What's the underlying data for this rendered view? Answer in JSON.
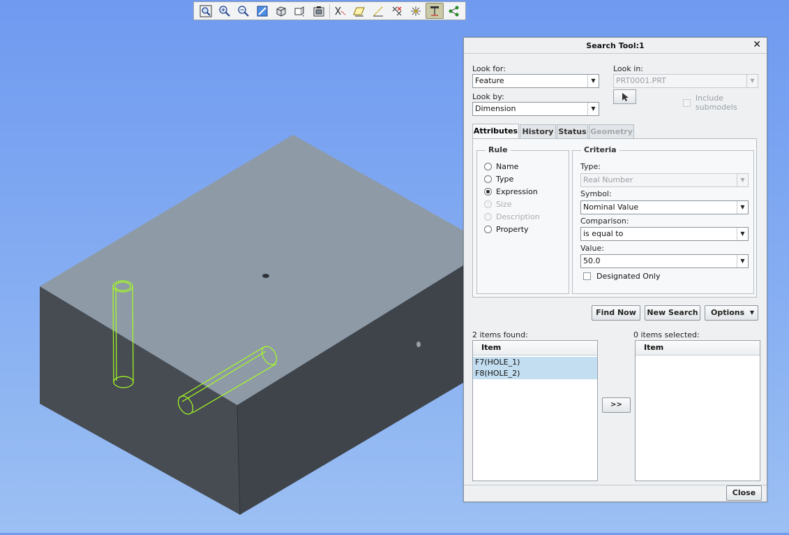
{
  "toolbar": {
    "buttons": [
      {
        "name": "refit-icon"
      },
      {
        "name": "zoom-in-icon"
      },
      {
        "name": "zoom-out-icon"
      },
      {
        "name": "repaint-icon"
      },
      {
        "name": "display-style-icon"
      },
      {
        "name": "saved-orientations-icon"
      },
      {
        "name": "view-manager-icon"
      },
      {
        "name": "datum-display-icon"
      },
      {
        "name": "plane-display-icon"
      },
      {
        "name": "axis-display-icon"
      },
      {
        "name": "point-display-icon"
      },
      {
        "name": "csys-display-icon"
      },
      {
        "name": "annotation-display-icon"
      },
      {
        "name": "spin-center-icon"
      }
    ]
  },
  "dialog": {
    "title": "Search Tool:1",
    "look_for_label": "Look for:",
    "look_for_value": "Feature",
    "look_by_label": "Look by:",
    "look_by_value": "Dimension",
    "look_in_label": "Look in:",
    "look_in_value": "PRT0001.PRT",
    "include_submodels_label": "Include submodels",
    "tabs": [
      "Attributes",
      "History",
      "Status",
      "Geometry"
    ],
    "rule_legend": "Rule",
    "rules": [
      "Name",
      "Type",
      "Expression",
      "Size",
      "Description",
      "Property"
    ],
    "criteria_legend": "Criteria",
    "type_label": "Type:",
    "type_value": "Real Number",
    "symbol_label": "Symbol:",
    "symbol_value": "Nominal Value",
    "comparison_label": "Comparison:",
    "comparison_value": "is equal to",
    "value_label": "Value:",
    "value_value": "50.0",
    "designated_only_label": "Designated Only",
    "find_now": "Find Now",
    "new_search": "New Search",
    "options": "Options",
    "found_label": "2 items found:",
    "selected_label": "0 items selected:",
    "column_item": "Item",
    "found_items": [
      "F7(HOLE_1)",
      "F8(HOLE_2)"
    ],
    "move_button": ">>",
    "close": "Close"
  },
  "colors": {
    "background_top": "#6f9af0",
    "selection": "#c3def0",
    "highlight": "#9cff1a"
  }
}
